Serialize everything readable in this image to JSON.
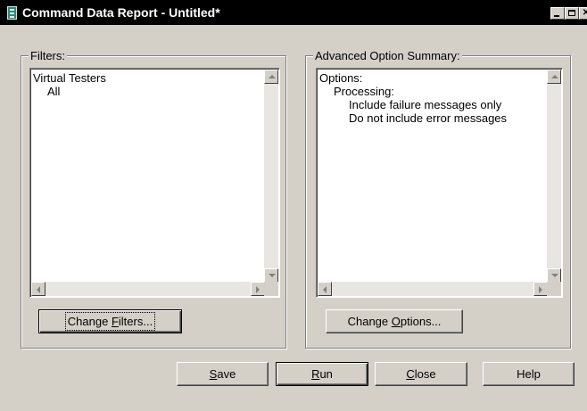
{
  "window": {
    "title": "Command Data Report - Untitled*",
    "controls": [
      "minimize-icon",
      "maximize-icon",
      "close-icon"
    ]
  },
  "filters": {
    "label": "Filters:",
    "lines": [
      "Virtual Testers",
      "All"
    ],
    "change_button": {
      "prefix": "Change ",
      "mnemonic": "F",
      "suffix": "ilters..."
    }
  },
  "options": {
    "label": "Advanced Option Summary:",
    "lines": [
      "Options:",
      "Processing:",
      "Include failure messages only",
      "Do not include error messages"
    ],
    "change_button": {
      "prefix": "Change ",
      "mnemonic": "O",
      "suffix": "ptions..."
    }
  },
  "buttons": {
    "save": {
      "mnemonic": "S",
      "rest": "ave"
    },
    "run": {
      "mnemonic": "R",
      "rest": "un"
    },
    "close": {
      "mnemonic": "C",
      "rest": "lose"
    },
    "help": {
      "label": "Help"
    }
  }
}
